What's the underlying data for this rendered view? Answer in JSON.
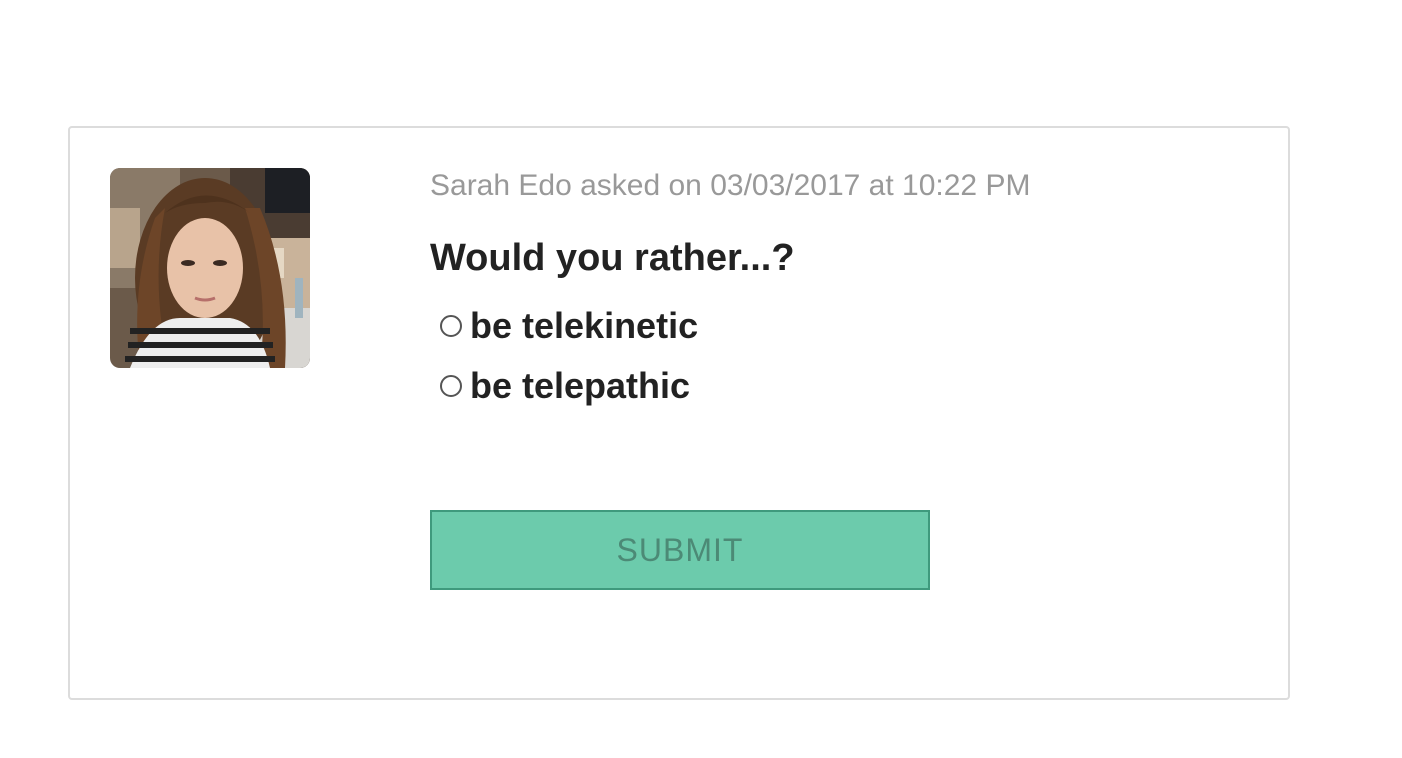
{
  "poll": {
    "author_line": "Sarah Edo asked on 03/03/2017 at 10:22 PM",
    "question": "Would you rather...?",
    "options": [
      {
        "label": "be telekinetic",
        "selected": false
      },
      {
        "label": "be telepathic",
        "selected": false
      }
    ],
    "submit_label": "SUBMIT",
    "submit_enabled": false
  },
  "avatar": {
    "description": "user-avatar-photo"
  },
  "colors": {
    "submit_bg": "#6ccbac",
    "submit_border": "#3f9a7d",
    "submit_text": "#4c8a76",
    "meta_text": "#999999",
    "card_border": "#dcdcdc"
  }
}
